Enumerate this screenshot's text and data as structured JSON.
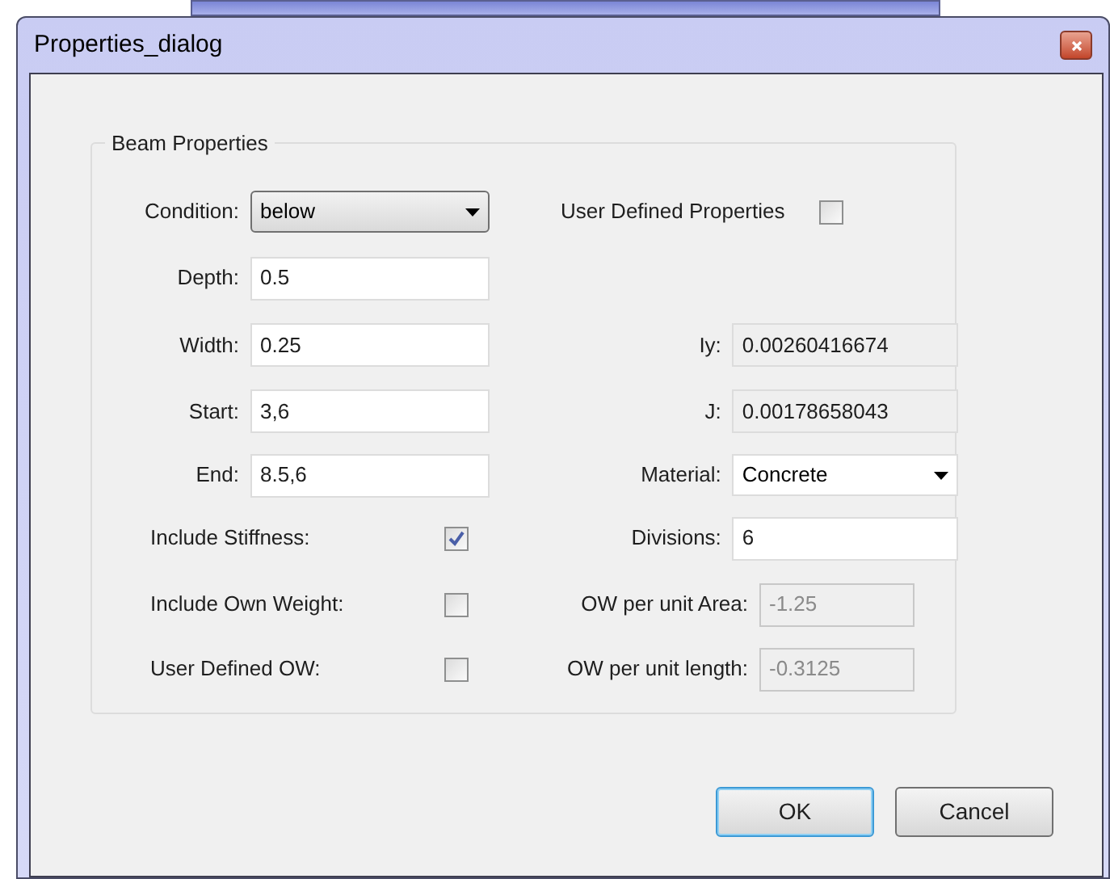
{
  "window": {
    "title": "Properties_dialog"
  },
  "group": {
    "title": "Beam Properties",
    "rows": [
      {
        "left": {
          "kind": "dropdown",
          "label": "Condition:",
          "value": "below"
        },
        "right": {
          "kind": "checkbox",
          "label": "User Defined Properties",
          "checked": false
        }
      },
      {
        "left": {
          "kind": "field",
          "label": "Depth:",
          "value": "0.5",
          "readonly": false,
          "disabled": false
        }
      },
      {
        "left": {
          "kind": "field",
          "label": "Width:",
          "value": "0.25",
          "readonly": false,
          "disabled": false
        },
        "right": {
          "kind": "field",
          "label": "Iy:",
          "value": "0.00260416674",
          "readonly": true,
          "disabled": false
        }
      },
      {
        "left": {
          "kind": "field",
          "label": "Start:",
          "value": "3,6",
          "readonly": false,
          "disabled": false
        },
        "right": {
          "kind": "field",
          "label": "J:",
          "value": "0.00178658043",
          "readonly": true,
          "disabled": false
        }
      },
      {
        "left": {
          "kind": "field",
          "label": "End:",
          "value": "8.5,6",
          "readonly": false,
          "disabled": false
        },
        "right": {
          "kind": "dropdown",
          "label": "Material:",
          "value": "Concrete"
        }
      },
      {
        "left": {
          "kind": "checkbox",
          "label": "Include Stiffness:",
          "checked": true
        },
        "right": {
          "kind": "field",
          "label": "Divisions:",
          "value": "6",
          "readonly": false,
          "disabled": false
        }
      },
      {
        "left": {
          "kind": "checkbox",
          "label": "Include Own Weight:",
          "checked": false
        },
        "right": {
          "kind": "field",
          "label": "OW per unit Area:",
          "value": "-1.25",
          "readonly": true,
          "disabled": true
        }
      },
      {
        "left": {
          "kind": "checkbox",
          "label": "User Defined OW:",
          "checked": false
        },
        "right": {
          "kind": "field",
          "label": "OW per unit length:",
          "value": "-0.3125",
          "readonly": true,
          "disabled": true
        }
      }
    ]
  },
  "buttons": [
    {
      "label": "OK",
      "default": true
    },
    {
      "label": "Cancel",
      "default": false
    }
  ]
}
